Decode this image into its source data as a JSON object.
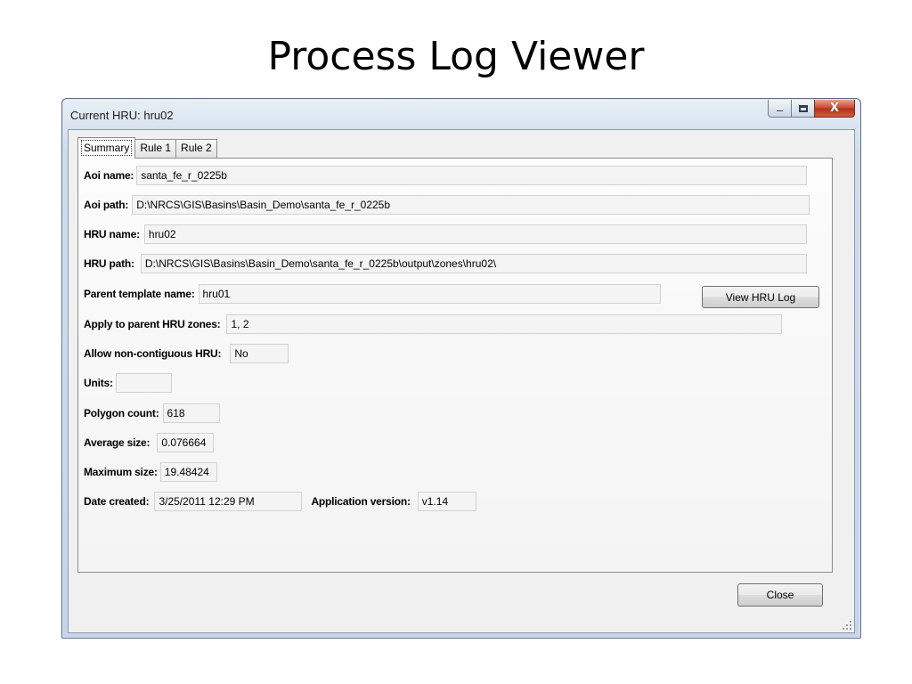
{
  "slide": {
    "title": "Process Log Viewer"
  },
  "window": {
    "title": "Current HRU: hru02",
    "close_glyph": "X"
  },
  "tabs": [
    "Summary",
    "Rule 1",
    "Rule 2"
  ],
  "summary": {
    "aoi_name": {
      "label": "Aoi name:",
      "value": "santa_fe_r_0225b"
    },
    "aoi_path": {
      "label": "Aoi path:",
      "value": "D:\\NRCS\\GIS\\Basins\\Basin_Demo\\santa_fe_r_0225b"
    },
    "hru_name": {
      "label": "HRU name:",
      "value": "hru02"
    },
    "hru_path": {
      "label": "HRU path:",
      "value": "D:\\NRCS\\GIS\\Basins\\Basin_Demo\\santa_fe_r_0225b\\output\\zones\\hru02\\"
    },
    "parent_template": {
      "label": "Parent template name:",
      "value": "hru01"
    },
    "apply_parent_zones": {
      "label": "Apply to parent HRU zones:",
      "value": "1, 2"
    },
    "allow_noncontiguous": {
      "label": "Allow non-contiguous HRU:",
      "value": "No"
    },
    "units": {
      "label": "Units:",
      "value": ""
    },
    "polygon_count": {
      "label": "Polygon count:",
      "value": "618"
    },
    "average_size": {
      "label": "Average size:",
      "value": "0.076664"
    },
    "maximum_size": {
      "label": "Maximum size:",
      "value": "19.48424"
    },
    "date_created": {
      "label": "Date created:",
      "value": "3/25/2011 12:29 PM"
    },
    "app_version": {
      "label": "Application version:",
      "value": "v1.14"
    }
  },
  "buttons": {
    "view_log": "View HRU Log",
    "close": "Close"
  }
}
